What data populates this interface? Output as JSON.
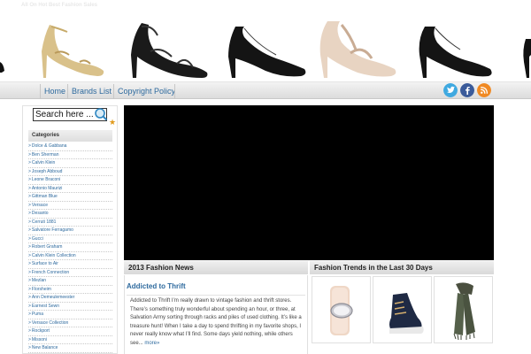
{
  "header": {
    "tagline": "All On Hot Best Fashion Sales"
  },
  "nav": {
    "items": [
      "Home",
      "Brands List",
      "Copyright Policy"
    ],
    "social": [
      "twitter-icon",
      "facebook-icon",
      "rss-icon"
    ]
  },
  "sidebar": {
    "search_value": "Search here ...",
    "categories_title": "Categories",
    "categories": [
      "Dolce & Gabbana",
      "Ben Sherman",
      "Calvin Klein",
      "Joseph Abboud",
      "Leone Braconi",
      "Antonio Maurizi",
      "Gittman Blue",
      "Versace",
      "Desanto",
      "Cerruti 1881",
      "Salvatore Ferragamo",
      "Gucci",
      "Robert Graham",
      "Calvin Klein Collection",
      "Surface to Air",
      "French Connection",
      "Mezlan",
      "Florsheim",
      "Ann Demeulemeester",
      "Earnest Sewn",
      "Puma",
      "Versace Collection",
      "Rockport",
      "Missoni",
      "New Balance"
    ]
  },
  "news": {
    "section_title": "2013 Fashion News",
    "article_title": "Addicted to Thrift",
    "article_body": "Addicted to Thrift I’m really drawn to vintage fashion and thrift stores. There’s something truly wonderful about spending an hour, or three, at Salvation Army sorting through racks and piles of used clothing. It’s like a treasure hunt! When I take a day to spend thrifting in my favorite shops, I never really know what I’ll find. Some days yield nothing, while others see... ",
    "more_label": "more»"
  },
  "trends": {
    "section_title": "Fashion Trends in the Last 30 Days"
  },
  "colors": {
    "link": "#2e6a9e",
    "video": "#000000"
  }
}
